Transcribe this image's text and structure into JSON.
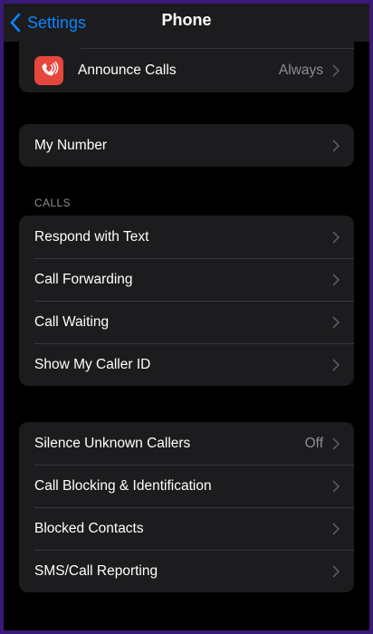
{
  "nav": {
    "back_label": "Settings",
    "title": "Phone"
  },
  "announce": {
    "label": "Announce Calls",
    "value": "Always"
  },
  "my_number": {
    "label": "My Number"
  },
  "calls_section": {
    "header": "CALLS",
    "items": [
      {
        "label": "Respond with Text"
      },
      {
        "label": "Call Forwarding"
      },
      {
        "label": "Call Waiting"
      },
      {
        "label": "Show My Caller ID"
      }
    ]
  },
  "callers_section": {
    "items": [
      {
        "label": "Silence Unknown Callers",
        "value": "Off"
      },
      {
        "label": "Call Blocking & Identification"
      },
      {
        "label": "Blocked Contacts"
      },
      {
        "label": "SMS/Call Reporting"
      }
    ]
  },
  "colors": {
    "accent": "#0a84ff",
    "icon_red": "#e5473d",
    "cell_bg": "#1c1c1e",
    "secondary_text": "#8e8e93"
  },
  "icons": {
    "announce": "phone-sound-icon",
    "chevron": "chevron-right-icon",
    "back": "chevron-left-icon"
  }
}
